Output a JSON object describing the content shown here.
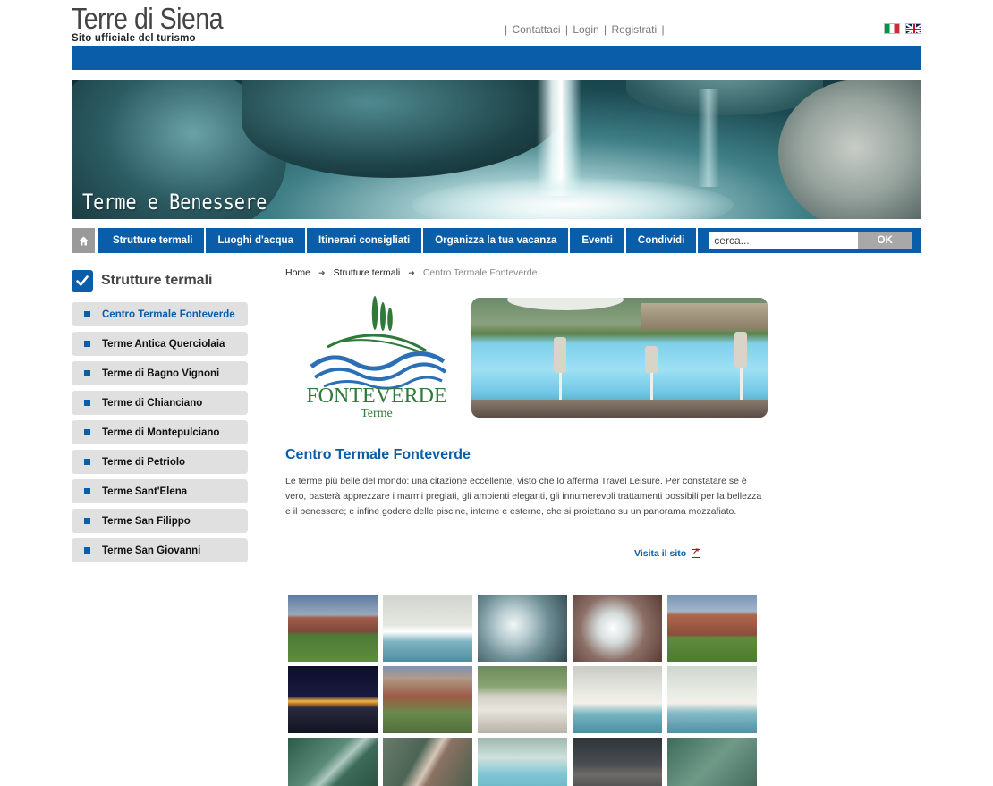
{
  "header": {
    "logo_title": "Terre di Siena",
    "logo_subtitle": "Sito ufficiale del turismo",
    "links": [
      "Contattaci",
      "Login",
      "Registrati"
    ],
    "languages": [
      "it-flag-icon",
      "uk-flag-icon"
    ]
  },
  "banner": {
    "title": "Terme e Benessere"
  },
  "nav": {
    "home_icon": "home-icon",
    "items": [
      "Strutture termali",
      "Luoghi d'acqua",
      "Itinerari consigliati",
      "Organizza la tua vacanza",
      "Eventi",
      "Condividi"
    ],
    "search_placeholder": "cerca...",
    "search_button": "OK"
  },
  "sidebar": {
    "title": "Strutture termali",
    "items": [
      {
        "label": "Centro Termale Fonteverde",
        "active": true
      },
      {
        "label": "Terme Antica Querciolaia",
        "active": false
      },
      {
        "label": "Terme di Bagno Vignoni",
        "active": false
      },
      {
        "label": "Terme di Chianciano",
        "active": false
      },
      {
        "label": "Terme di Montepulciano",
        "active": false
      },
      {
        "label": "Terme di Petriolo",
        "active": false
      },
      {
        "label": "Terme Sant'Elena",
        "active": false
      },
      {
        "label": "Terme San Filippo",
        "active": false
      },
      {
        "label": "Terme San Giovanni",
        "active": false
      }
    ]
  },
  "breadcrumb": [
    "Home",
    "Strutture termali",
    "Centro Termale Fonteverde"
  ],
  "main": {
    "logo_brand": "FONTEVERDE",
    "logo_sub": "Terme",
    "title": "Centro Termale Fonteverde",
    "description": "Le terme più belle del mondo: una citazione eccellente, visto che lo afferma Travel Leisure. Per constatare se è vero, basterà apprezzare i marmi pregiati, gli ambienti eleganti, gli innumerevoli trattamenti possibili per la bellezza e il benessere; e infine godere delle piscine, interne e esterne, che si proiettano su un panorama mozzafiato.",
    "visit_label": "Visita il sito"
  },
  "colors": {
    "brand_blue": "#0a5ea9",
    "sidebar_item_bg": "#e0e0e0",
    "nav_home_bg": "#9a9a9a"
  }
}
